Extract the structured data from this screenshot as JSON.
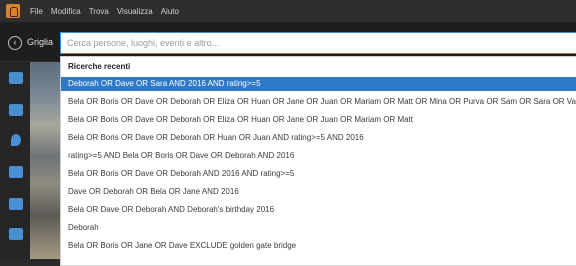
{
  "menu": [
    "File",
    "Modifica",
    "Trova",
    "Visualizza",
    "Aiuto"
  ],
  "toolbar": {
    "back_label": "Griglia"
  },
  "search": {
    "placeholder": "Cerca persone, luoghi, eventi e altro..."
  },
  "recent": {
    "header": "Ricerche recenti",
    "items": [
      "Deborah OR Dave OR Sara AND 2016 AND rating>=5",
      "Bela OR Boris OR Dave OR Deborah OR Eliza OR Huan OR Jane OR Juan OR Mariam OR Matt OR Mina OR Purva OR Sam OR Sara OR Valeri",
      "Bela OR Boris OR Dave OR Deborah OR Eliza OR Huan OR Jane OR Juan OR Mariam OR Matt",
      "Bela OR Boris OR Dave OR Deborah OR Huan OR Juan AND rating>=5 AND 2016",
      "rating>=5 AND Bela OR Boris OR Dave OR Deborah AND 2016",
      "Bela OR Boris OR Dave OR Deborah AND 2016 AND rating>=5",
      "Dave OR Deborah OR Bela OR Jane AND 2016",
      "Bela OR Dave OR Deborah AND Deborah's birthday 2016",
      "Deborah",
      "Bela OR Boris OR Jane OR Dave EXCLUDE golden gate bridge"
    ]
  },
  "colors": {
    "accent": "#2f79c9",
    "toolbar_bg": "#1e1e1e",
    "menubar_bg": "#2e2e2e"
  },
  "sidebar_icons": [
    "events-icon",
    "people-icon",
    "places-icon",
    "calendar-icon",
    "folders-icon",
    "albums-icon"
  ]
}
